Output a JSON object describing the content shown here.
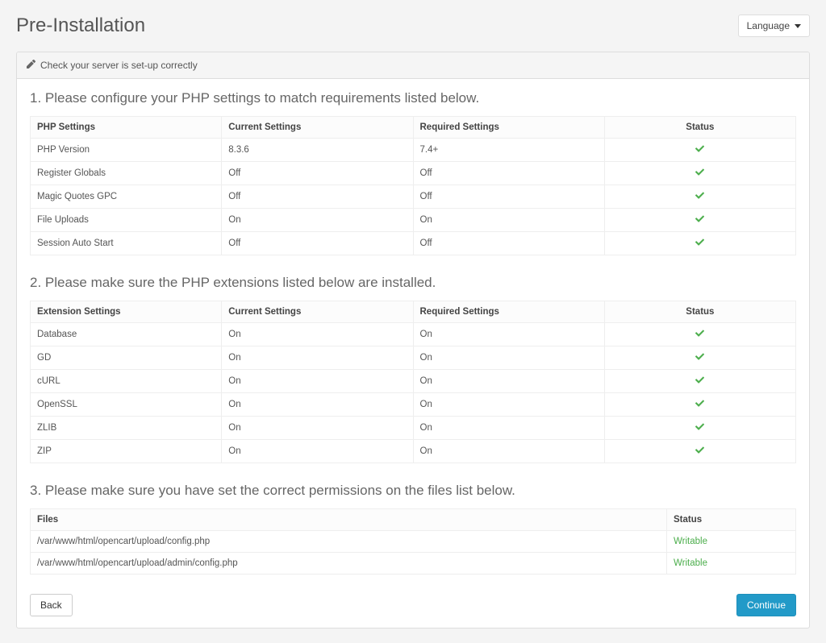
{
  "header": {
    "title": "Pre-Installation",
    "language_label": "Language"
  },
  "panel": {
    "heading": "Check your server is set-up correctly"
  },
  "sections": {
    "s1": {
      "heading": "1. Please configure your PHP settings to match requirements listed below.",
      "columns": {
        "c1": "PHP Settings",
        "c2": "Current Settings",
        "c3": "Required Settings",
        "c4": "Status"
      },
      "rows": [
        {
          "name": "PHP Version",
          "current": "8.3.6",
          "required": "7.4+",
          "status": "ok"
        },
        {
          "name": "Register Globals",
          "current": "Off",
          "required": "Off",
          "status": "ok"
        },
        {
          "name": "Magic Quotes GPC",
          "current": "Off",
          "required": "Off",
          "status": "ok"
        },
        {
          "name": "File Uploads",
          "current": "On",
          "required": "On",
          "status": "ok"
        },
        {
          "name": "Session Auto Start",
          "current": "Off",
          "required": "Off",
          "status": "ok"
        }
      ]
    },
    "s2": {
      "heading": "2. Please make sure the PHP extensions listed below are installed.",
      "columns": {
        "c1": "Extension Settings",
        "c2": "Current Settings",
        "c3": "Required Settings",
        "c4": "Status"
      },
      "rows": [
        {
          "name": "Database",
          "current": "On",
          "required": "On",
          "status": "ok"
        },
        {
          "name": "GD",
          "current": "On",
          "required": "On",
          "status": "ok"
        },
        {
          "name": "cURL",
          "current": "On",
          "required": "On",
          "status": "ok"
        },
        {
          "name": "OpenSSL",
          "current": "On",
          "required": "On",
          "status": "ok"
        },
        {
          "name": "ZLIB",
          "current": "On",
          "required": "On",
          "status": "ok"
        },
        {
          "name": "ZIP",
          "current": "On",
          "required": "On",
          "status": "ok"
        }
      ]
    },
    "s3": {
      "heading": "3. Please make sure you have set the correct permissions on the files list below.",
      "columns": {
        "c1": "Files",
        "c2": "Status"
      },
      "rows": [
        {
          "file": "/var/www/html/opencart/upload/config.php",
          "status": "Writable"
        },
        {
          "file": "/var/www/html/opencart/upload/admin/config.php",
          "status": "Writable"
        }
      ]
    }
  },
  "buttons": {
    "back": "Back",
    "continue": "Continue"
  }
}
